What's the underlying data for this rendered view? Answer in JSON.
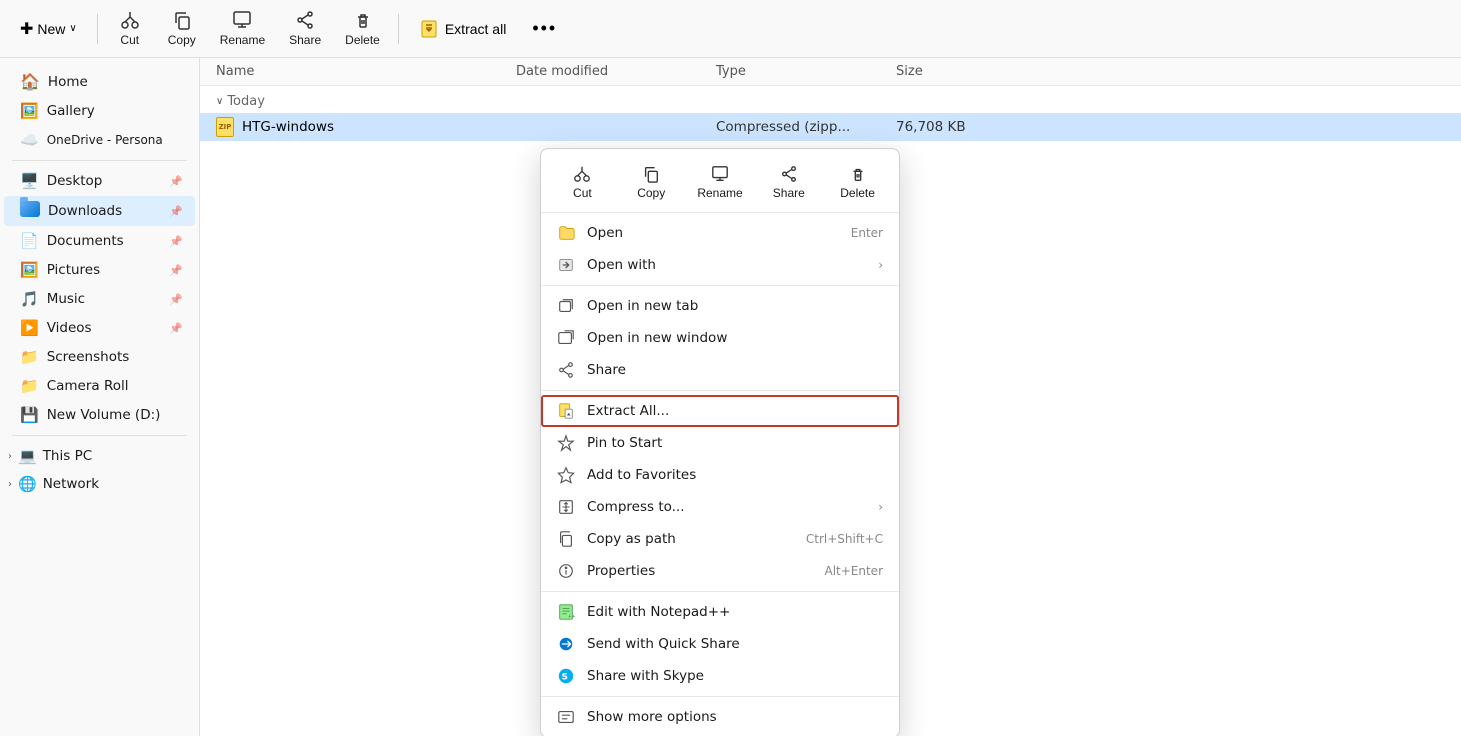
{
  "toolbar": {
    "new_label": "New",
    "new_arrow": "∨",
    "cut_label": "Cut",
    "copy_label": "Copy",
    "rename_label": "Rename",
    "share_label": "Share",
    "delete_label": "Delete",
    "extract_all_label": "Extract all",
    "more_label": "•••"
  },
  "sidebar": {
    "home": "Home",
    "gallery": "Gallery",
    "onedrive": "OneDrive - Persona",
    "pinned_items": [
      {
        "id": "desktop",
        "label": "Desktop",
        "pinned": true,
        "type": "desktop"
      },
      {
        "id": "downloads",
        "label": "Downloads",
        "pinned": true,
        "active": true,
        "type": "downloads"
      },
      {
        "id": "documents",
        "label": "Documents",
        "pinned": true,
        "type": "documents"
      },
      {
        "id": "pictures",
        "label": "Pictures",
        "pinned": true,
        "type": "pictures"
      },
      {
        "id": "music",
        "label": "Music",
        "pinned": true,
        "type": "music"
      },
      {
        "id": "videos",
        "label": "Videos",
        "pinned": true,
        "type": "videos"
      },
      {
        "id": "screenshots",
        "label": "Screenshots",
        "type": "screenshots"
      },
      {
        "id": "camera-roll",
        "label": "Camera Roll",
        "type": "camera"
      },
      {
        "id": "new-volume",
        "label": "New Volume (D:)",
        "type": "volume"
      }
    ],
    "this_pc_label": "This PC",
    "network_label": "Network"
  },
  "content": {
    "columns": {
      "name": "Name",
      "date": "Date modified",
      "type": "Type",
      "size": "Size"
    },
    "group_today": "Today",
    "file": {
      "name": "HTG-windows",
      "type": "Compressed (zipp...",
      "size": "76,708 KB"
    }
  },
  "context_menu": {
    "icon_row": [
      {
        "id": "cut",
        "label": "Cut"
      },
      {
        "id": "copy",
        "label": "Copy"
      },
      {
        "id": "rename",
        "label": "Rename"
      },
      {
        "id": "share",
        "label": "Share"
      },
      {
        "id": "delete",
        "label": "Delete"
      }
    ],
    "items": [
      {
        "id": "open",
        "label": "Open",
        "shortcut": "Enter",
        "icon": "folder-open"
      },
      {
        "id": "open-with",
        "label": "Open with",
        "arrow": true,
        "icon": "open-with"
      },
      {
        "id": "separator1",
        "type": "separator"
      },
      {
        "id": "open-new-tab",
        "label": "Open in new tab",
        "icon": "new-tab"
      },
      {
        "id": "open-new-window",
        "label": "Open in new window",
        "icon": "new-window"
      },
      {
        "id": "share2",
        "label": "Share",
        "icon": "share"
      },
      {
        "id": "separator2",
        "type": "separator"
      },
      {
        "id": "extract-all",
        "label": "Extract All...",
        "icon": "extract",
        "highlighted": true
      },
      {
        "id": "pin-start",
        "label": "Pin to Start",
        "icon": "pin"
      },
      {
        "id": "add-favorites",
        "label": "Add to Favorites",
        "icon": "star"
      },
      {
        "id": "compress-to",
        "label": "Compress to...",
        "arrow": true,
        "icon": "compress"
      },
      {
        "id": "copy-path",
        "label": "Copy as path",
        "shortcut": "Ctrl+Shift+C",
        "icon": "copy-path"
      },
      {
        "id": "properties",
        "label": "Properties",
        "shortcut": "Alt+Enter",
        "icon": "properties"
      },
      {
        "id": "separator3",
        "type": "separator"
      },
      {
        "id": "notepad-plus",
        "label": "Edit with Notepad++",
        "icon": "notepad"
      },
      {
        "id": "quick-share",
        "label": "Send with Quick Share",
        "icon": "quick-share"
      },
      {
        "id": "skype",
        "label": "Share with Skype",
        "icon": "skype"
      },
      {
        "id": "separator4",
        "type": "separator"
      },
      {
        "id": "more-options",
        "label": "Show more options",
        "icon": "more-options"
      }
    ]
  }
}
